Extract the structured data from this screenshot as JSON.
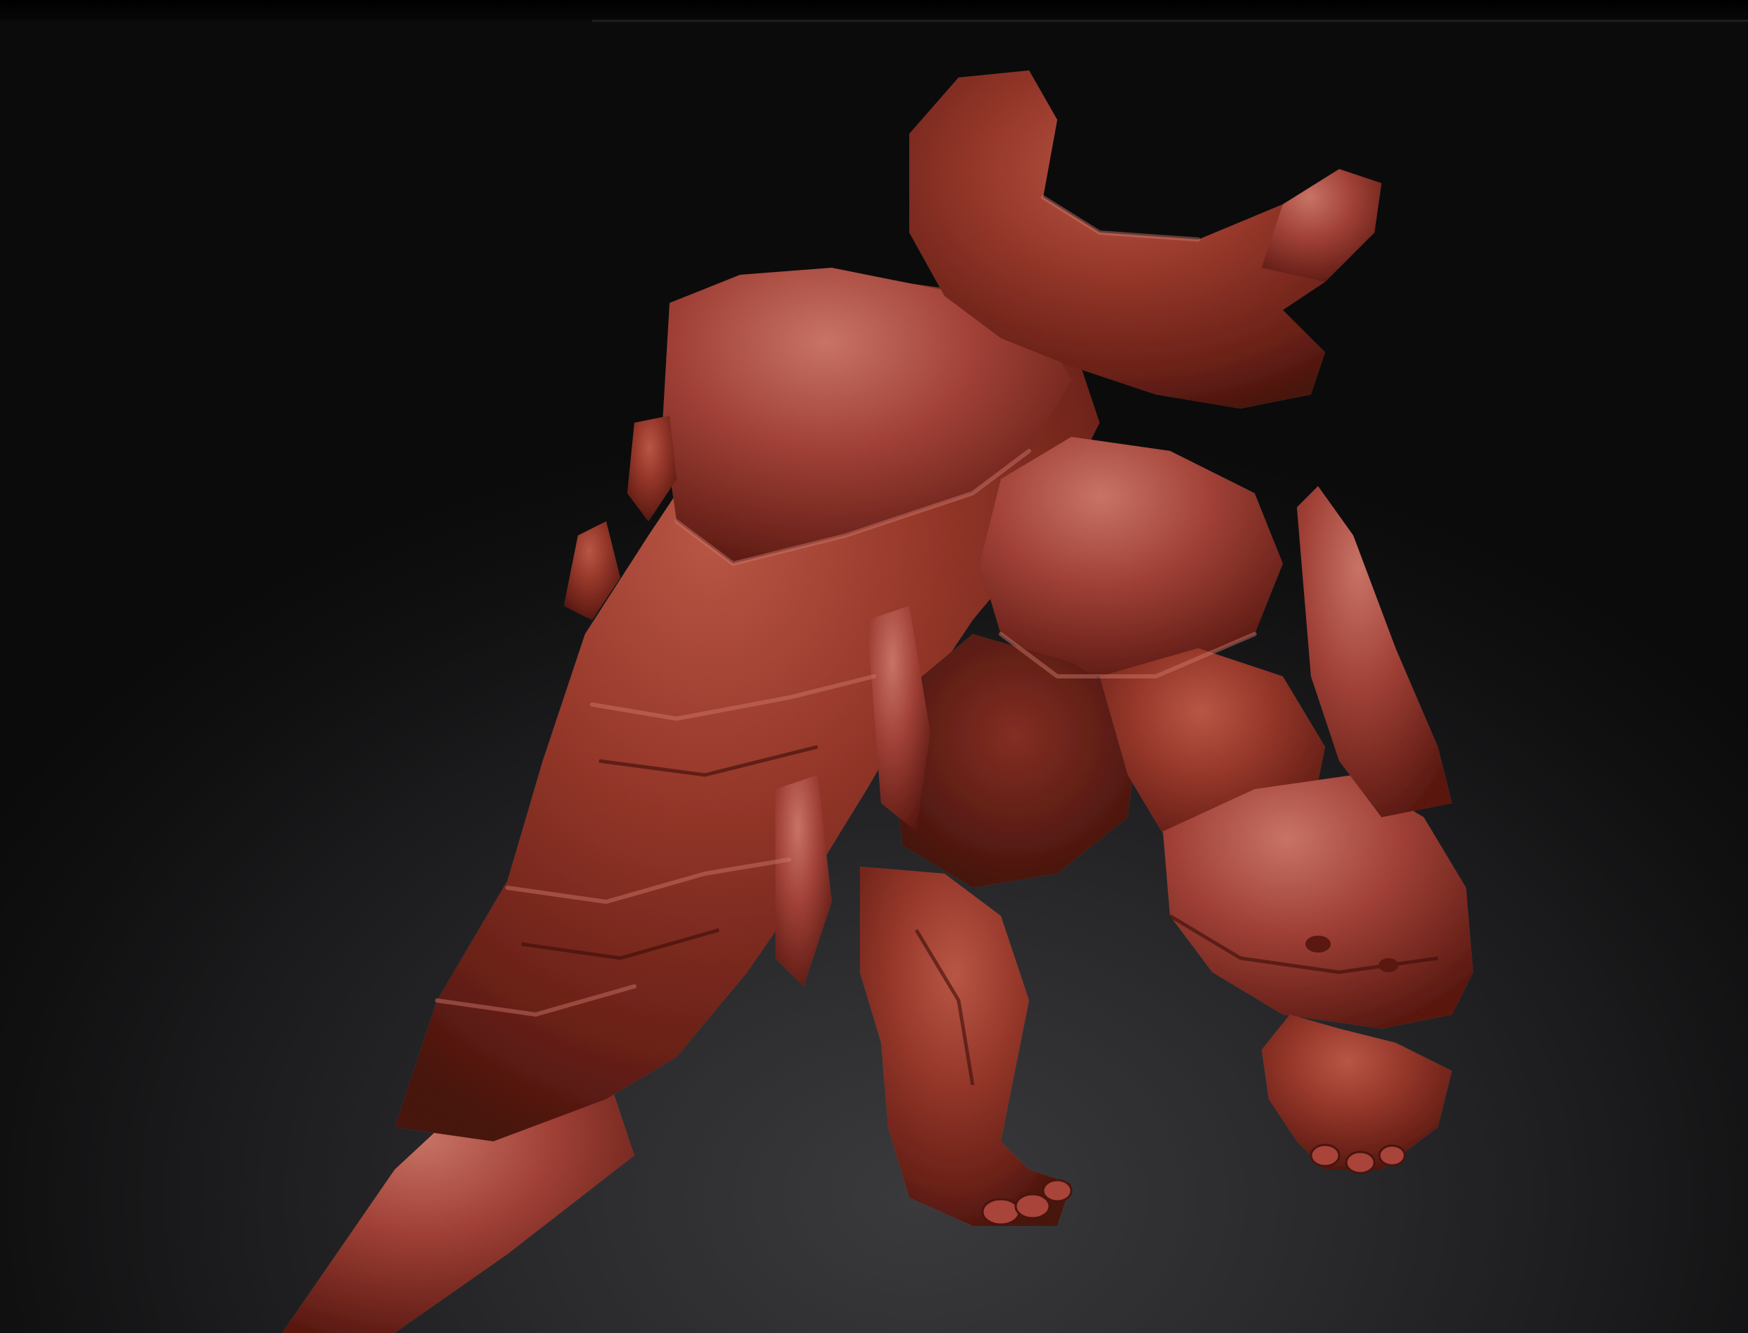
{
  "viewport": {
    "background_color": "#2b2b2d",
    "model": {
      "icon": "sculpt-model",
      "material_color": "#9c3a2c",
      "highlight_color": "#c8685a",
      "shadow_color": "#4a140e"
    }
  }
}
